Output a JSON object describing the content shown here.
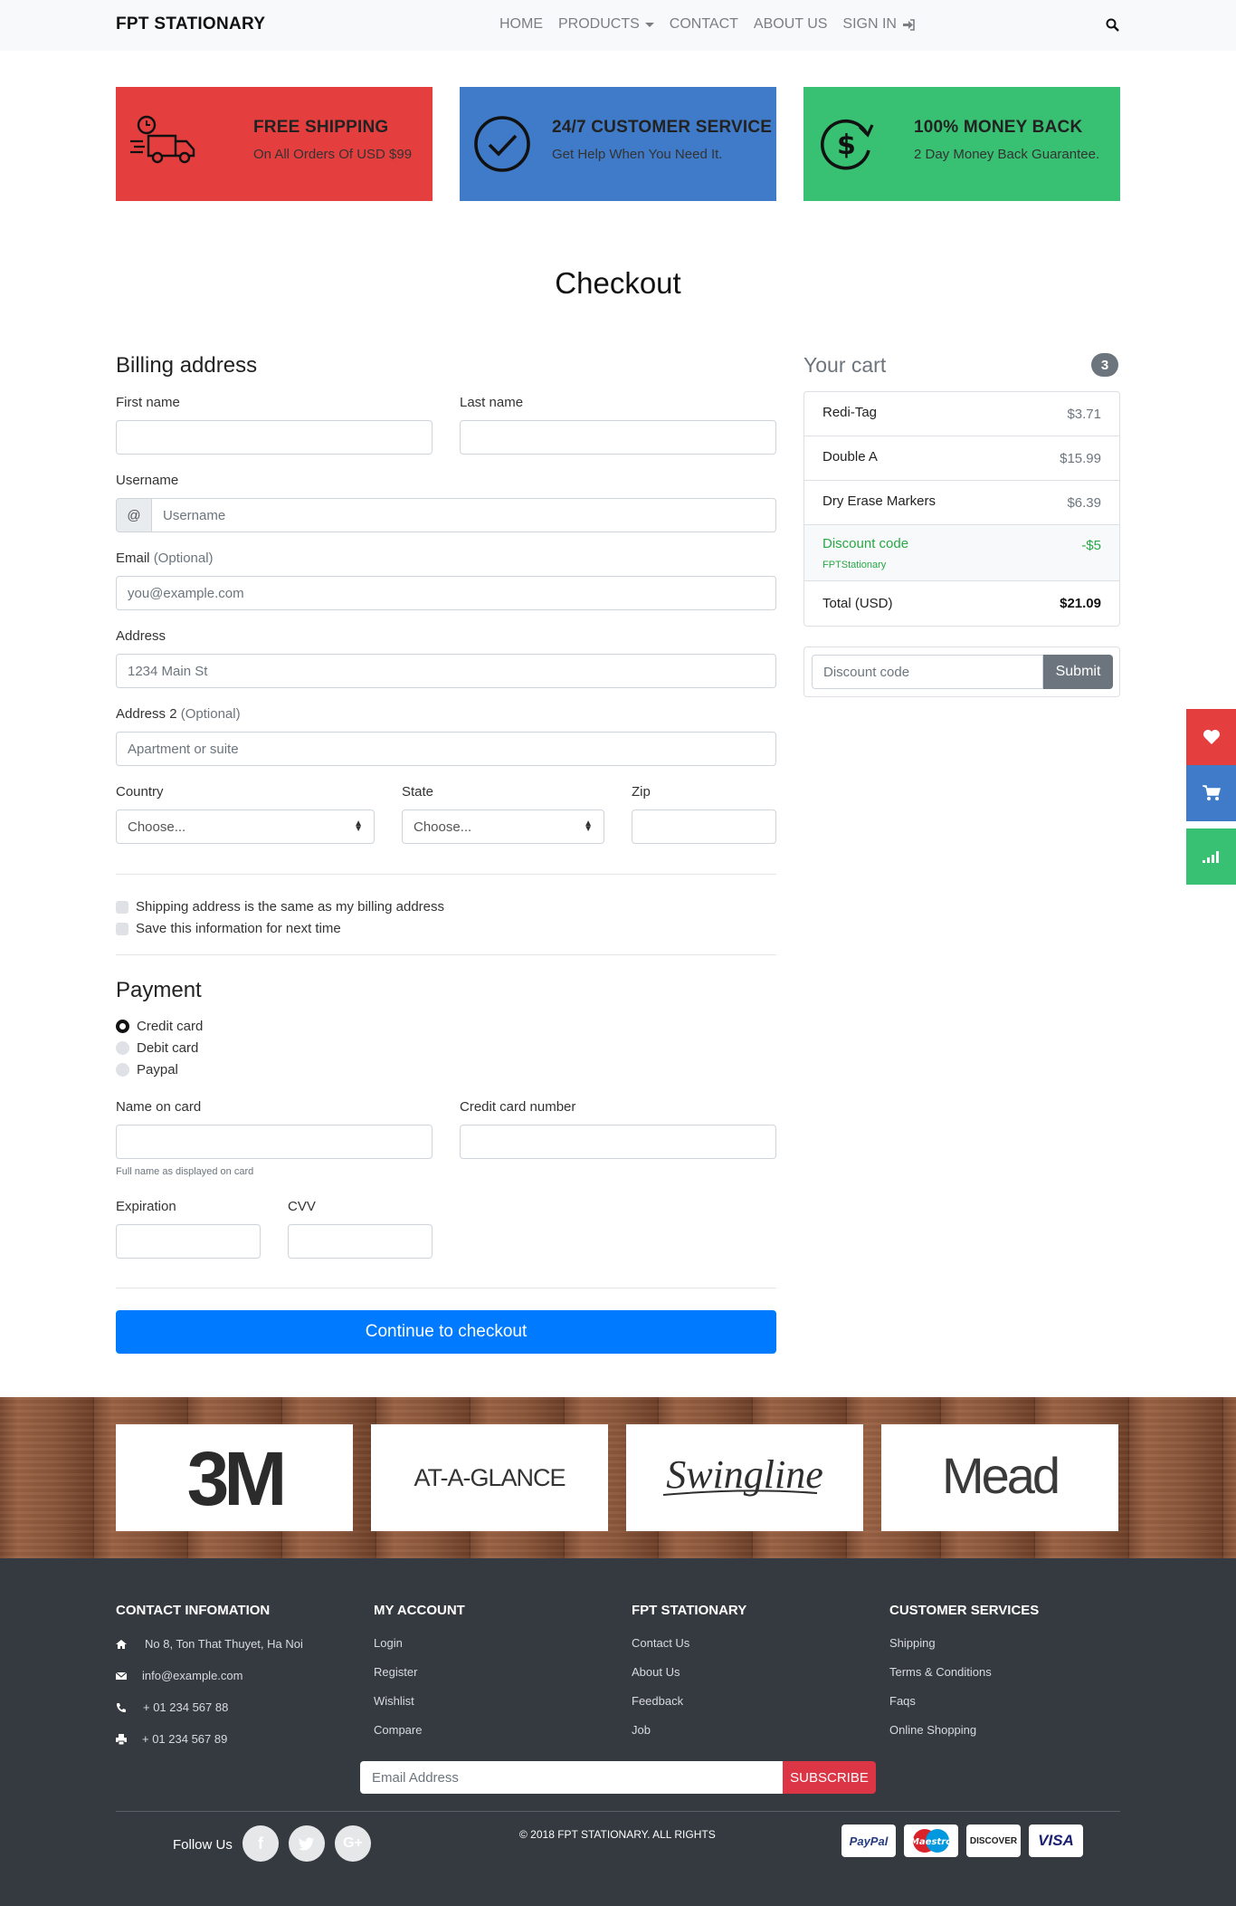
{
  "nav": {
    "brand": "FPT STATIONARY",
    "items": [
      "HOME",
      "PRODUCTS",
      "CONTACT",
      "ABOUT US",
      "SIGN IN"
    ]
  },
  "features": [
    {
      "title": "FREE SHIPPING",
      "subtitle": "On All Orders Of USD $99",
      "icon": "truck-icon",
      "color": "#e53e3e"
    },
    {
      "title": "24/7 CUSTOMER SERVICE",
      "subtitle": "Get Help When You Need It.",
      "icon": "check-circle-icon",
      "color": "#3f7bc9"
    },
    {
      "title": "100% MONEY BACK",
      "subtitle": "2 Day Money Back Guarantee.",
      "icon": "dollar-refresh-icon",
      "color": "#38c172"
    }
  ],
  "page_title": "Checkout",
  "billing": {
    "title": "Billing address",
    "first_name": "First name",
    "last_name": "Last name",
    "username": "Username",
    "username_prefix": "@",
    "username_placeholder": "Username",
    "email": "Email",
    "email_optional": "(Optional)",
    "email_placeholder": "you@example.com",
    "address": "Address",
    "address_placeholder": "1234 Main St",
    "address2": "Address 2",
    "address2_optional": "(Optional)",
    "address2_placeholder": "Apartment or suite",
    "country": "Country",
    "country_value": "Choose...",
    "state": "State",
    "state_value": "Choose...",
    "zip": "Zip",
    "same_address": "Shipping address is the same as my billing address",
    "save_info": "Save this information for next time"
  },
  "payment": {
    "title": "Payment",
    "methods": [
      "Credit card",
      "Debit card",
      "Paypal"
    ],
    "selected": "Credit card",
    "name_on_card": "Name on card",
    "name_hint": "Full name as displayed on card",
    "card_number": "Credit card number",
    "expiration": "Expiration",
    "cvv": "CVV",
    "submit": "Continue to checkout"
  },
  "cart": {
    "title": "Your cart",
    "count": "3",
    "items": [
      {
        "name": "Redi-Tag",
        "price": "$3.71"
      },
      {
        "name": "Double A",
        "price": "$15.99"
      },
      {
        "name": "Dry Erase Markers",
        "price": "$6.39"
      }
    ],
    "discount": {
      "label": "Discount code",
      "code": "FPTStationary",
      "amount": "-$5"
    },
    "total_label": "Total (USD)",
    "total": "$21.09",
    "promo_placeholder": "Discount code",
    "promo_button": "Submit"
  },
  "brands": [
    "3M",
    "AT-A-GLANCE",
    "Swingline",
    "Mead"
  ],
  "footer": {
    "contact": {
      "title": "CONTACT INFOMATION",
      "address": "No 8, Ton That Thuyet, Ha Noi",
      "email": "info@example.com",
      "phone": "+ 01 234 567 88",
      "fax": "+ 01 234 567 89"
    },
    "account": {
      "title": "MY ACCOUNT",
      "links": [
        "Login",
        "Register",
        "Wishlist",
        "Compare"
      ]
    },
    "company": {
      "title": "FPT STATIONARY",
      "links": [
        "Contact Us",
        "About Us",
        "Feedback",
        "Job"
      ]
    },
    "services": {
      "title": "CUSTOMER SERVICES",
      "links": [
        "Shipping",
        "Terms & Conditions",
        "Faqs",
        "Online Shopping"
      ]
    },
    "newsletter_placeholder": "Email Address",
    "subscribe": "SUBSCRIBE",
    "follow": "Follow Us",
    "copyright": "© 2018 FPT STATIONARY. ALL RIGHTS",
    "payment_cards": [
      "PayPal",
      "Maestro",
      "DISCOVER",
      "VISA"
    ]
  }
}
